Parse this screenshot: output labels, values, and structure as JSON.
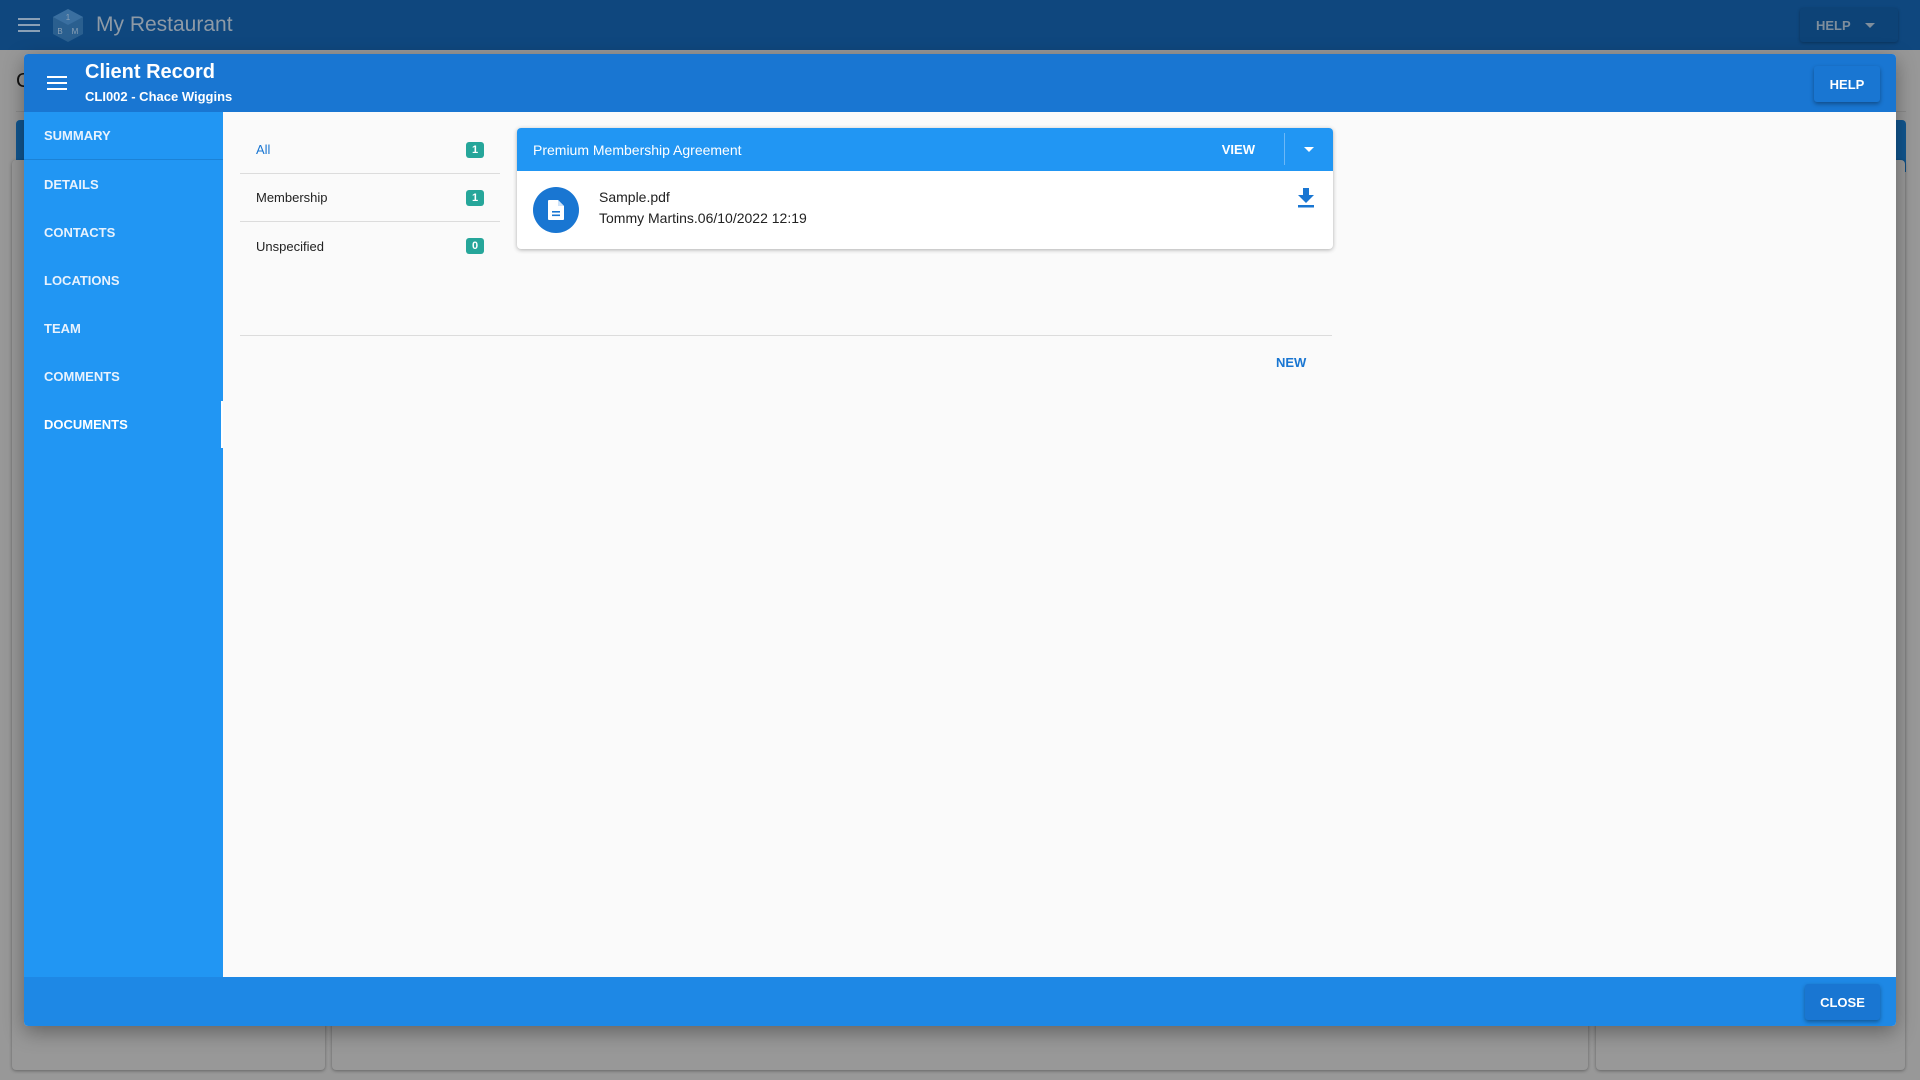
{
  "app": {
    "title": "My Restaurant",
    "help_label": "HELP",
    "logo_letters": [
      "1",
      "B",
      "M"
    ],
    "background_letter": "C"
  },
  "dialog": {
    "title": "Client Record",
    "subtitle": "CLI002 - Chace Wiggins",
    "help_label": "HELP",
    "close_label": "CLOSE"
  },
  "sidebar": {
    "items": [
      {
        "label": "SUMMARY"
      },
      {
        "label": "DETAILS"
      },
      {
        "label": "CONTACTS"
      },
      {
        "label": "LOCATIONS"
      },
      {
        "label": "TEAM"
      },
      {
        "label": "COMMENTS"
      },
      {
        "label": "DOCUMENTS",
        "active": true
      }
    ]
  },
  "filters": [
    {
      "label": "All",
      "count": "1",
      "active": true
    },
    {
      "label": "Membership",
      "count": "1"
    },
    {
      "label": "Unspecified",
      "count": "0"
    }
  ],
  "document": {
    "title": "Premium Membership Agreement",
    "view_label": "VIEW",
    "file_name": "Sample.pdf",
    "meta": "Tommy Martins.06/10/2022 12:19"
  },
  "new_label": "NEW",
  "colors": {
    "primary": "#1976d2",
    "sidebar": "#2196f3",
    "badge": "#26a69a",
    "appbar": "#0f477e"
  }
}
